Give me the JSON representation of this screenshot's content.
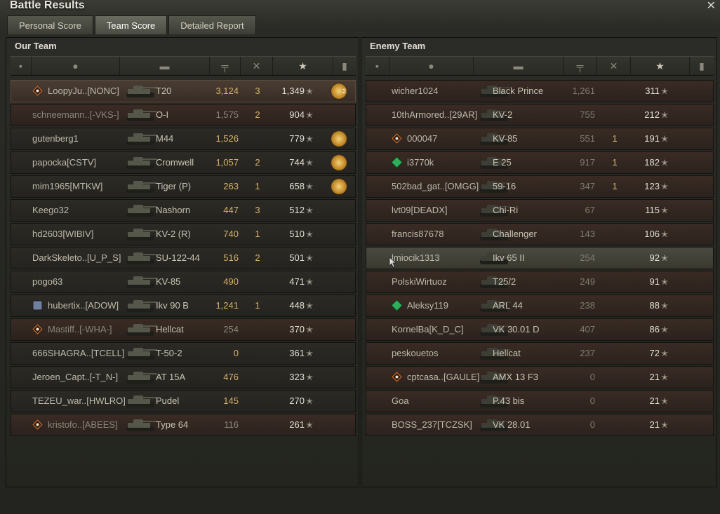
{
  "window": {
    "title": "Battle Results",
    "close_icon": "close-icon"
  },
  "tabs": [
    {
      "label": "Personal Score",
      "active": false
    },
    {
      "label": "Team Score",
      "active": true
    },
    {
      "label": "Detailed Report",
      "active": false
    }
  ],
  "columns": {
    "icons": [
      "squad-icon",
      "player-icon",
      "tank-icon",
      "damage-icon",
      "kills-icon",
      "sort-arrow-icon",
      "xp-star-icon",
      "medal-icon"
    ]
  },
  "our_team": {
    "title": "Our Team",
    "rows": [
      {
        "player": "LoopyJu..[NONC]",
        "tank": "T20",
        "damage": "3,124",
        "kills": "3",
        "xp": "1,349",
        "medal": true,
        "medal_count": "2",
        "highlight": "me",
        "ribbon": "diamond"
      },
      {
        "player": "schneemann..[-VKS-]",
        "tank": "O-I",
        "damage": "1,575",
        "kills": "2",
        "xp": "904",
        "medal": false,
        "highlight": "dead"
      },
      {
        "player": "gutenberg1",
        "tank": "M44",
        "damage": "1,526",
        "kills": "",
        "xp": "779",
        "medal": true
      },
      {
        "player": "papocka[CSTV]",
        "tank": "Cromwell",
        "damage": "1,057",
        "kills": "2",
        "xp": "744",
        "medal": true
      },
      {
        "player": "mim1965[MTKW]",
        "tank": "Tiger (P)",
        "damage": "263",
        "kills": "1",
        "xp": "658",
        "medal": true
      },
      {
        "player": "Keego32",
        "tank": "Nashorn",
        "damage": "447",
        "kills": "3",
        "xp": "512",
        "medal": false
      },
      {
        "player": "hd2603[WIBIV]",
        "tank": "KV-2 (R)",
        "damage": "740",
        "kills": "1",
        "xp": "510",
        "medal": false
      },
      {
        "player": "DarkSkeleto..[U_P_S]",
        "tank": "SU-122-44",
        "damage": "516",
        "kills": "2",
        "xp": "501",
        "medal": false
      },
      {
        "player": "pogo63",
        "tank": "KV-85",
        "damage": "490",
        "kills": "",
        "xp": "471",
        "medal": false
      },
      {
        "player": "hubertix..[ADOW]",
        "tank": "Ikv 90 B",
        "damage": "1,241",
        "kills": "1",
        "xp": "448",
        "medal": false,
        "ribbon": "clan"
      },
      {
        "player": "Mastiff..[-WHA-]",
        "tank": "Hellcat",
        "damage": "254",
        "kills": "",
        "xp": "370",
        "medal": false,
        "highlight": "dead",
        "ribbon": "diamond"
      },
      {
        "player": "666SHAGRA..[TCELL]",
        "tank": "T-50-2",
        "damage": "0",
        "kills": "",
        "xp": "361",
        "medal": false
      },
      {
        "player": "Jeroen_Capt..[-T_N-]",
        "tank": "AT 15A",
        "damage": "476",
        "kills": "",
        "xp": "323",
        "medal": false
      },
      {
        "player": "TEZEU_war..[HWLRO]",
        "tank": "Pudel",
        "damage": "145",
        "kills": "",
        "xp": "270",
        "medal": false
      },
      {
        "player": "kristofo..[ABEES]",
        "tank": "Type 64",
        "damage": "116",
        "kills": "",
        "xp": "261",
        "medal": false,
        "highlight": "dead",
        "ribbon": "diamond"
      }
    ]
  },
  "enemy_team": {
    "title": "Enemy Team",
    "rows": [
      {
        "player": "wicher1024",
        "tank": "Black Prince",
        "damage": "1,261",
        "kills": "",
        "xp": "311"
      },
      {
        "player": "10thArmored..[29AR]",
        "tank": "KV-2",
        "damage": "755",
        "kills": "",
        "xp": "212"
      },
      {
        "player": "000047",
        "tank": "KV-85",
        "damage": "551",
        "kills": "1",
        "xp": "191",
        "ribbon": "diamond"
      },
      {
        "player": "i3770k",
        "tank": "E 25",
        "damage": "917",
        "kills": "1",
        "xp": "182",
        "ribbon": "green"
      },
      {
        "player": "502bad_gat..[OMGG]",
        "tank": "59-16",
        "damage": "347",
        "kills": "1",
        "xp": "123"
      },
      {
        "player": "lvt09[DEADX]",
        "tank": "Chi-Ri",
        "damage": "67",
        "kills": "",
        "xp": "115"
      },
      {
        "player": "francis87678",
        "tank": "Challenger",
        "damage": "143",
        "kills": "",
        "xp": "106"
      },
      {
        "player": "lmiocik1313",
        "tank": "Ikv 65 II",
        "damage": "254",
        "kills": "",
        "xp": "92",
        "hover": true
      },
      {
        "player": "PolskiWirtuoz",
        "tank": "T25/2",
        "damage": "249",
        "kills": "",
        "xp": "91"
      },
      {
        "player": "Aleksy119",
        "tank": "ARL 44",
        "damage": "238",
        "kills": "",
        "xp": "88",
        "ribbon": "green"
      },
      {
        "player": "KornelBa[K_D_C]",
        "tank": "VK 30.01 D",
        "damage": "407",
        "kills": "",
        "xp": "86"
      },
      {
        "player": "peskouetos",
        "tank": "Hellcat",
        "damage": "237",
        "kills": "",
        "xp": "72"
      },
      {
        "player": "cptcasa..[GAULE]",
        "tank": "AMX 13 F3",
        "damage": "0",
        "kills": "",
        "xp": "21",
        "ribbon": "diamond"
      },
      {
        "player": "Goa",
        "tank": "P.43 bis",
        "damage": "0",
        "kills": "",
        "xp": "21"
      },
      {
        "player": "BOSS_237[TCZSK]",
        "tank": "VK 28.01",
        "damage": "0",
        "kills": "",
        "xp": "21"
      }
    ]
  },
  "colors": {
    "accent": "#d7b26a",
    "row_dark": "#2c2a25",
    "row_red": "#3a2b24",
    "ribbon_green": "#2fae5a",
    "ribbon_diamond": "#d9722b"
  }
}
